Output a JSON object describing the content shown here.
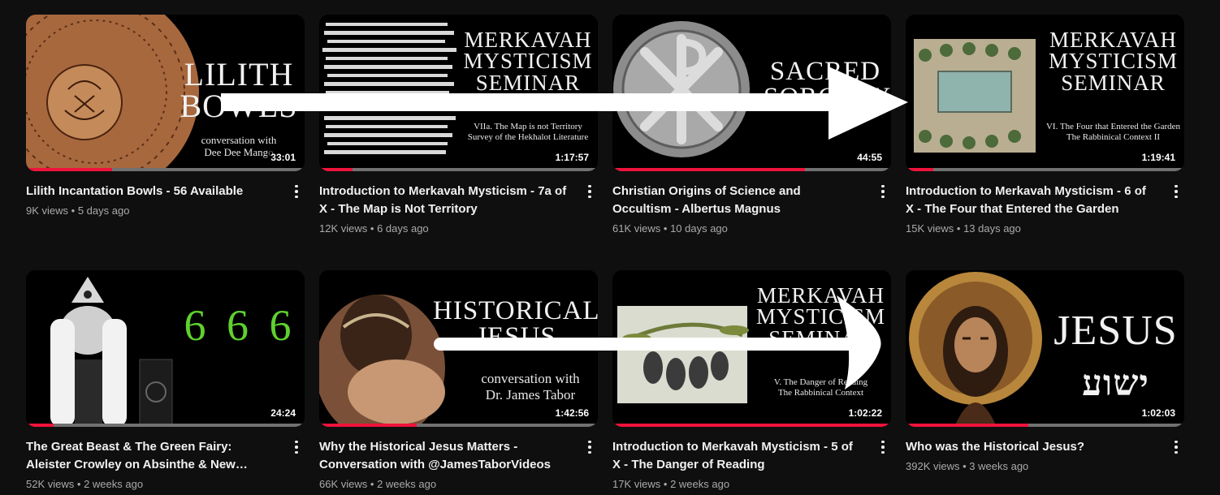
{
  "videos": [
    {
      "title": "Lilith Incantation Bowls - 56 Available",
      "views": "9K views",
      "age": "5 days ago",
      "duration": "33:01",
      "progress": 0.31,
      "thumb": {
        "title_lines": [
          "LILITH",
          "BOWLS"
        ],
        "sub_lines": [
          "conversation with",
          "Dee Dee Mango"
        ]
      }
    },
    {
      "title": "Introduction to Merkavah Mysticism - 7a of X - The Map is Not Territory",
      "views": "12K views",
      "age": "6 days ago",
      "duration": "1:17:57",
      "progress": 0.12,
      "thumb": {
        "title_lines": [
          "MERKAVAH",
          "MYSTICISM",
          "SEMINAR"
        ],
        "sub_lines": [
          "VIIa. The Map is not Territory",
          "Survey of the Hekhalot Literature"
        ]
      }
    },
    {
      "title": "Christian Origins of Science and Occultism - Albertus Magnus",
      "views": "61K views",
      "age": "10 days ago",
      "duration": "44:55",
      "progress": 0.69,
      "thumb": {
        "title_lines": [
          "SACRED",
          "SORCERY"
        ],
        "sub_lines": []
      }
    },
    {
      "title": "Introduction to Merkavah Mysticism - 6 of X - The Four that Entered the Garden",
      "views": "15K views",
      "age": "13 days ago",
      "duration": "1:19:41",
      "progress": 0.1,
      "thumb": {
        "title_lines": [
          "MERKAVAH",
          "MYSTICISM",
          "SEMINAR"
        ],
        "sub_lines": [
          "VI. The Four that Entered the Garden",
          "The Rabbinical Context II"
        ]
      }
    },
    {
      "title": "The Great Beast & The Green Fairy: Aleister Crowley on Absinthe & New Orleans…",
      "views": "52K views",
      "age": "2 weeks ago",
      "duration": "24:24",
      "progress": 0.1,
      "thumb": {
        "title_lines": [
          "6 6 6"
        ],
        "sub_lines": []
      }
    },
    {
      "title": "Why the Historical Jesus Matters - Conversation with @JamesTaborVideos",
      "views": "66K views",
      "age": "2 weeks ago",
      "duration": "1:42:56",
      "progress": 0.35,
      "thumb": {
        "title_lines": [
          "HISTORICAL",
          "JESUS"
        ],
        "sub_lines": [
          "conversation with",
          "Dr. James Tabor"
        ]
      }
    },
    {
      "title": "Introduction to Merkavah Mysticism - 5 of X - The Danger of Reading",
      "views": "17K views",
      "age": "2 weeks ago",
      "duration": "1:02:22",
      "progress": 1.0,
      "thumb": {
        "title_lines": [
          "MERKAVAH",
          "MYSTICISM",
          "SEMINAR"
        ],
        "sub_lines": [
          "V. The Danger of Reading",
          "The Rabbinical Context"
        ]
      }
    },
    {
      "title": "Who was the Historical Jesus?",
      "views": "392K views",
      "age": "3 weeks ago",
      "duration": "1:02:03",
      "progress": 0.44,
      "thumb": {
        "title_lines": [
          "JESUS",
          "ישוע"
        ],
        "sub_lines": []
      }
    }
  ],
  "stats_separator": "•",
  "colors": {
    "progress": "#f0133b",
    "progress_track": "#717171",
    "background": "#0f0f0f"
  },
  "icons": {
    "menu": "more-vert-icon"
  }
}
